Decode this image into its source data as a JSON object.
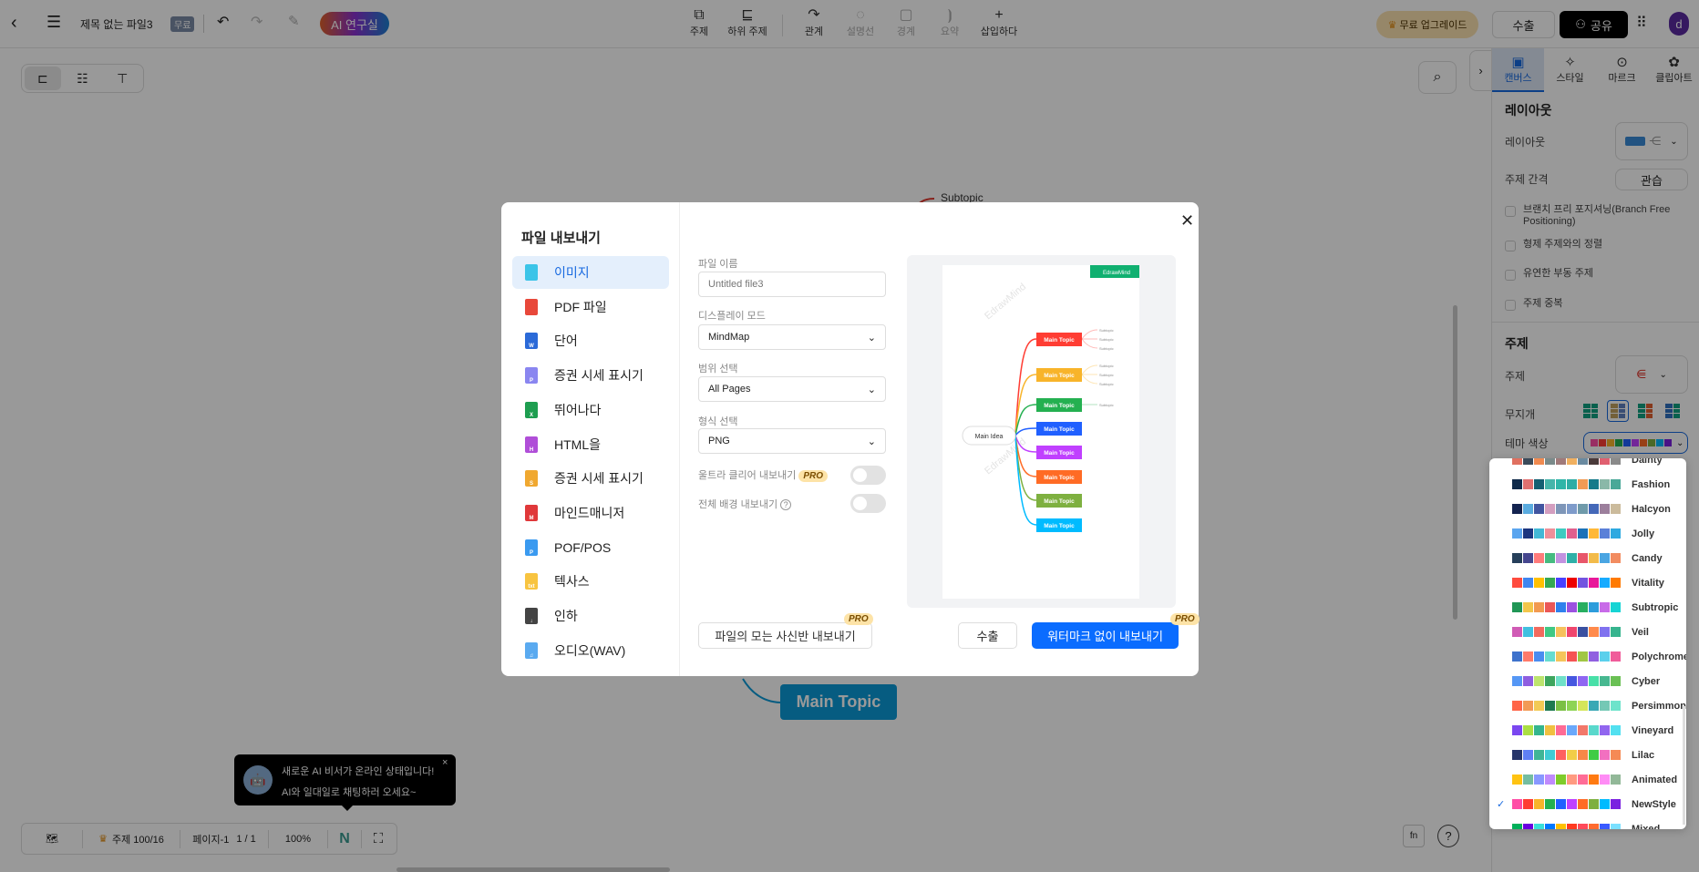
{
  "header": {
    "title": "제목 없는 파일3",
    "badge": "무료",
    "ai_label": "AI 연구실",
    "upgrade": "무료 업그레이드",
    "export": "수출",
    "share": "공유",
    "avatar": "d"
  },
  "toolbar": [
    {
      "label": "주제",
      "icon": "topic-icon",
      "disabled": false
    },
    {
      "label": "하위 주제",
      "icon": "subtopic-icon",
      "disabled": false
    },
    {
      "label": "관계",
      "icon": "relation-icon",
      "disabled": false
    },
    {
      "label": "설명선",
      "icon": "callout-icon",
      "disabled": true
    },
    {
      "label": "경계",
      "icon": "boundary-icon",
      "disabled": true
    },
    {
      "label": "요약",
      "icon": "summary-icon",
      "disabled": true
    },
    {
      "label": "삽입하다",
      "icon": "plus-icon",
      "disabled": false
    }
  ],
  "canvas": {
    "subtopic": "Subtopic",
    "main_topic": "Main Topic",
    "main_topic_color": "#0a9ad8"
  },
  "panel": {
    "tabs": [
      {
        "label": "캔버스",
        "icon": "canvas-icon"
      },
      {
        "label": "스타일",
        "icon": "sparkle-icon"
      },
      {
        "label": "마르크",
        "icon": "mark-icon"
      },
      {
        "label": "클립아트",
        "icon": "clipart-icon"
      }
    ],
    "layout_heading": "레이아웃",
    "layout_label": "레이아웃",
    "spacing_label": "주제 간격",
    "spacing_value": "관습",
    "checks": [
      "브랜치 프리 포지셔닝(Branch Free Positioning)",
      "형제 주제와의 정렬",
      "유연한 부동 주제",
      "주제 중복"
    ],
    "topic_heading": "주제",
    "topic_label": "주제",
    "rainbow_label": "무지개",
    "theme_color_label": "테마 색상"
  },
  "modal": {
    "title": "파일 내보내기",
    "nav": [
      {
        "label": "이미지",
        "color": "#3bc4e8",
        "tag": ""
      },
      {
        "label": "PDF 파일",
        "color": "#e8483a",
        "tag": ""
      },
      {
        "label": "단어",
        "color": "#2b6ad8",
        "tag": "W"
      },
      {
        "label": "증권 시세 표시기",
        "color": "#8a86f0",
        "tag": "P"
      },
      {
        "label": "뛰어나다",
        "color": "#1e9e50",
        "tag": "X"
      },
      {
        "label": "HTML을",
        "color": "#b04ed8",
        "tag": "H"
      },
      {
        "label": "증권 시세 표시기",
        "color": "#f0a830",
        "tag": "S"
      },
      {
        "label": "마인드매니저",
        "color": "#e0383a",
        "tag": "M"
      },
      {
        "label": "POF/POS",
        "color": "#3a9af0",
        "tag": "P"
      },
      {
        "label": "텍사스",
        "color": "#f8c440",
        "tag": "txt"
      },
      {
        "label": "인하",
        "color": "#444444",
        "tag": "↓"
      },
      {
        "label": "오디오(WAV)",
        "color": "#5aaaf0",
        "tag": "♫"
      }
    ],
    "file_name_label": "파일 이름",
    "file_name_placeholder": "Untitled file3",
    "display_label": "디스플레이 모드",
    "display_value": "MindMap",
    "range_label": "범위 선택",
    "range_value": "All Pages",
    "format_label": "형식 선택",
    "format_value": "PNG",
    "ultra_label": "울트라 클리어 내보내기",
    "pro": "PRO",
    "ultra_on": false,
    "bg_label": "전체 배경 내보내기",
    "bg_on": false,
    "export_all_label": "파일의 모는 사신반 내보내기",
    "cancel_label": "수출",
    "primary_label": "워터마크 없이 내보내기",
    "preview": {
      "main_idea": "Main Idea",
      "logo": "EdrawMind",
      "watermark": "EdrawMind",
      "topics": [
        {
          "label": "Main Topic",
          "color": "#ff3d33",
          "subs": [
            "Subtopic",
            "Subtopic",
            "Subtopic"
          ]
        },
        {
          "label": "Main Topic",
          "color": "#f8b42a",
          "subs": [
            "Subtopic",
            "Subtopic",
            "Subtopic"
          ]
        },
        {
          "label": "Main Topic",
          "color": "#24b050",
          "subs": [
            "Subtopic"
          ]
        },
        {
          "label": "Main Topic",
          "color": "#2060ff",
          "subs": []
        },
        {
          "label": "Main Topic",
          "color": "#c040ff",
          "subs": []
        },
        {
          "label": "Main Topic",
          "color": "#ff6b25",
          "subs": []
        },
        {
          "label": "Main Topic",
          "color": "#7eb040",
          "subs": []
        },
        {
          "label": "Main Topic",
          "color": "#00bbff",
          "subs": []
        }
      ]
    }
  },
  "theme_dropdown": {
    "selected": "NewStyle",
    "items": [
      {
        "name": "Dainty",
        "colors": [
          "#e07060",
          "#3a4a5a",
          "#f08a50",
          "#7a8a8a",
          "#a07a7a",
          "#f0b060",
          "#6a8aa0",
          "#4a3a3a",
          "#e06070",
          "#8a8a8a"
        ]
      },
      {
        "name": "Fashion",
        "colors": [
          "#0f2a4a",
          "#e07070",
          "#145f72",
          "#45b5aa",
          "#2fb5a8",
          "#2fada5",
          "#f19b55",
          "#157a8a",
          "#8ab8a8",
          "#4aa898"
        ]
      },
      {
        "name": "Halcyon",
        "colors": [
          "#13234f",
          "#5aabdf",
          "#4155a0",
          "#d39ebf",
          "#7e96b8",
          "#7e9bca",
          "#6f9aaa",
          "#4468b8",
          "#9c7f9c",
          "#cbbb9c"
        ]
      },
      {
        "name": "Jolly",
        "colors": [
          "#5aa5ef",
          "#1b3580",
          "#42b8d6",
          "#ee8f99",
          "#3fcac0",
          "#e0608e",
          "#1b72b8",
          "#ffb838",
          "#5a80d8",
          "#2ea9e0"
        ]
      },
      {
        "name": "Candy",
        "colors": [
          "#263f5a",
          "#45468e",
          "#ff7b7b",
          "#45bb80",
          "#c292e0",
          "#2fb0a8",
          "#e8566a",
          "#f2bb4a",
          "#4aa5e2",
          "#f28c60"
        ]
      },
      {
        "name": "Vitality",
        "colors": [
          "#ff4b3e",
          "#3f86f0",
          "#ffc000",
          "#34a853",
          "#4940ff",
          "#ee0000",
          "#7353e0",
          "#e8189a",
          "#17abff",
          "#ff7a00"
        ]
      },
      {
        "name": "Subtropic",
        "colors": [
          "#209655",
          "#f3c64b",
          "#f29a50",
          "#eb5757",
          "#2f80ed",
          "#9b51e0",
          "#27ae60",
          "#2d9cdb",
          "#c86be8",
          "#15d4d4"
        ]
      },
      {
        "name": "Veil",
        "colors": [
          "#d05bb5",
          "#40c0e0",
          "#f26a5e",
          "#40c884",
          "#f6c15c",
          "#ef466e",
          "#3a50a0",
          "#ff8a4c",
          "#8072ef",
          "#36b48e"
        ]
      },
      {
        "name": "Polychrome",
        "colors": [
          "#3e72cc",
          "#ff7a6a",
          "#4a8cf0",
          "#66dcd0",
          "#f5c45a",
          "#f55353",
          "#a0c643",
          "#9060e0",
          "#5bd0ec",
          "#f05c9a"
        ]
      },
      {
        "name": "Cyber",
        "colors": [
          "#5597f5",
          "#8e5ee0",
          "#bde46e",
          "#3ea55d",
          "#6fe0c8",
          "#4657e0",
          "#8f66f2",
          "#48e0a8",
          "#47b890",
          "#6ac054"
        ]
      },
      {
        "name": "Persimmon",
        "colors": [
          "#ff6548",
          "#f29a55",
          "#f2ca55",
          "#1e7950",
          "#7bc045",
          "#8ed455",
          "#d5e65a",
          "#3aa8b5",
          "#75c8b5",
          "#6ee3cb"
        ]
      },
      {
        "name": "Vineyard",
        "colors": [
          "#7b47f0",
          "#abdf43",
          "#34b58e",
          "#f0c040",
          "#ff6b95",
          "#6aa8fa",
          "#f2786a",
          "#5ad8cc",
          "#9166ef",
          "#52e0f0"
        ]
      },
      {
        "name": "Lilac",
        "colors": [
          "#26356a",
          "#6080f5",
          "#40b596",
          "#40ccd5",
          "#ff6060",
          "#f2cd48",
          "#f78848",
          "#40cc44",
          "#f270c0",
          "#f58a55"
        ]
      },
      {
        "name": "Animated",
        "colors": [
          "#ffc312",
          "#75bda0",
          "#8898ff",
          "#c08afc",
          "#7fcc2a",
          "#ff9a80",
          "#ff6c96",
          "#ff7a12",
          "#ff8cf5",
          "#92b898"
        ]
      },
      {
        "name": "NewStyle",
        "colors": [
          "#ff4da6",
          "#ff3d33",
          "#f8b42a",
          "#24b050",
          "#2060ff",
          "#c040ff",
          "#ff6b25",
          "#7eb040",
          "#00bbff",
          "#7a20e0"
        ]
      },
      {
        "name": "Mixed",
        "colors": [
          "#00b05a",
          "#6a00e0",
          "#38e0d8",
          "#0078ff",
          "#ffc000",
          "#ff3a20",
          "#ff4a5a",
          "#ff6b30",
          "#3a5aff",
          "#7ae0ff"
        ]
      }
    ]
  },
  "tooltip": {
    "line1": "새로운 AI 비서가 온라인 상태입니다!",
    "line2": "AI와 일대일로 채팅하러 오세요~"
  },
  "status": {
    "topics": "주제 100/16",
    "page": "페이지-1",
    "page_count": "1 / 1",
    "zoom": "100%"
  }
}
